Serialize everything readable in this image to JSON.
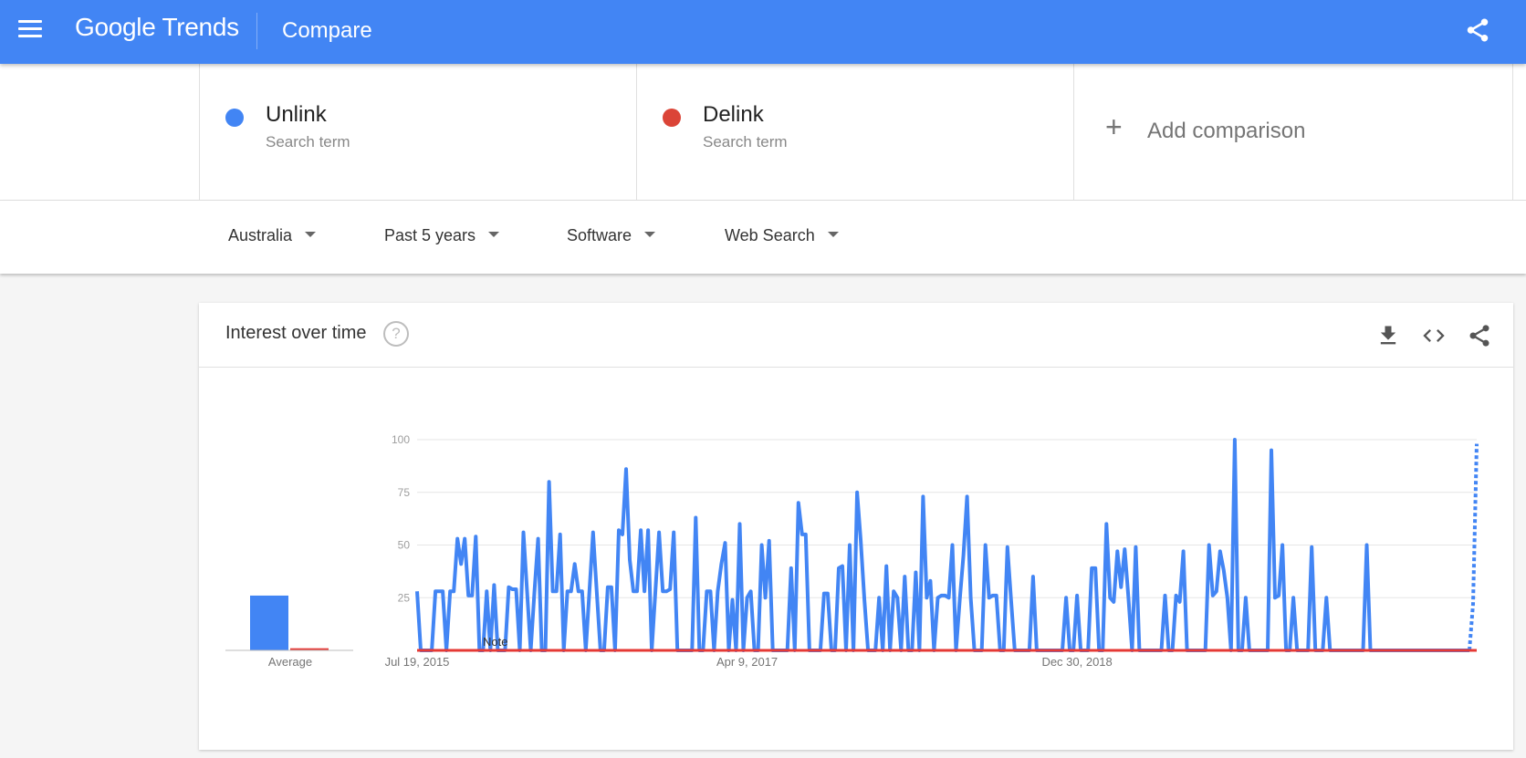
{
  "header": {
    "logo_google": "Google",
    "logo_trends": "Trends",
    "title": "Compare"
  },
  "terms": [
    {
      "name": "Unlink",
      "sub": "Search term",
      "color": "#4285f4"
    },
    {
      "name": "Delink",
      "sub": "Search term",
      "color": "#db4437"
    }
  ],
  "add_comparison": {
    "label": "Add comparison"
  },
  "filters": [
    "Australia",
    "Past 5 years",
    "Software",
    "Web Search"
  ],
  "card": {
    "title": "Interest over time",
    "help_glyph": "?"
  },
  "chart_data": {
    "type": "line",
    "x_tick_labels": [
      "Jul 19, 2015",
      "Apr 9, 2017",
      "Dec 30, 2018"
    ],
    "x_tick_index": [
      0,
      90,
      180
    ],
    "y_ticks": [
      25,
      50,
      75,
      100
    ],
    "ylim": [
      0,
      100
    ],
    "note_label": "Note",
    "average_label": "Average",
    "averages": [
      26,
      1
    ],
    "partial_from_index": 260,
    "series": [
      {
        "name": "Unlink",
        "color": "#4285f4",
        "values": [
          28,
          0,
          0,
          0,
          0,
          28,
          28,
          28,
          0,
          28,
          28,
          53,
          41,
          53,
          26,
          26,
          54,
          0,
          0,
          28,
          0,
          31,
          0,
          0,
          0,
          30,
          29,
          29,
          0,
          56,
          28,
          0,
          28,
          53,
          0,
          0,
          80,
          28,
          28,
          55,
          0,
          28,
          28,
          41,
          28,
          28,
          0,
          28,
          56,
          28,
          0,
          0,
          30,
          30,
          0,
          57,
          55,
          86,
          43,
          28,
          28,
          57,
          28,
          57,
          0,
          28,
          56,
          28,
          28,
          29,
          56,
          0,
          0,
          0,
          0,
          0,
          63,
          0,
          0,
          28,
          28,
          0,
          28,
          41,
          51,
          0,
          24,
          0,
          60,
          0,
          25,
          28,
          0,
          0,
          50,
          25,
          52,
          0,
          0,
          0,
          0,
          0,
          39,
          0,
          70,
          55,
          55,
          0,
          0,
          0,
          0,
          27,
          27,
          0,
          0,
          39,
          40,
          0,
          50,
          0,
          75,
          52,
          24,
          0,
          0,
          0,
          25,
          0,
          40,
          0,
          28,
          25,
          0,
          35,
          0,
          0,
          37,
          0,
          73,
          25,
          33,
          0,
          25,
          26,
          26,
          25,
          50,
          0,
          24,
          45,
          73,
          25,
          0,
          0,
          0,
          50,
          25,
          26,
          26,
          0,
          0,
          49,
          24,
          0,
          0,
          0,
          0,
          0,
          35,
          0,
          0,
          0,
          0,
          0,
          0,
          0,
          0,
          25,
          0,
          0,
          26,
          0,
          0,
          0,
          39,
          39,
          0,
          0,
          60,
          25,
          23,
          47,
          30,
          48,
          25,
          0,
          49,
          0,
          0,
          0,
          0,
          0,
          0,
          0,
          26,
          0,
          0,
          26,
          23,
          47,
          0,
          0,
          0,
          0,
          0,
          0,
          50,
          26,
          28,
          47,
          38,
          25,
          0,
          100,
          0,
          0,
          25,
          0,
          0,
          0,
          0,
          0,
          0,
          95,
          25,
          26,
          50,
          0,
          0,
          25,
          0,
          0,
          0,
          0,
          49,
          0,
          0,
          0,
          25,
          0,
          0,
          0,
          0,
          0,
          0,
          0,
          0,
          0,
          0,
          50,
          0,
          0,
          0,
          0,
          0,
          0,
          0,
          0,
          0,
          0,
          0,
          0,
          0,
          0,
          0,
          0,
          0,
          0,
          0,
          0,
          0,
          0,
          0,
          0,
          0,
          0,
          0,
          0
        ],
        "partial_values": [
          22,
          98
        ]
      },
      {
        "name": "Delink",
        "color": "#e53935",
        "values": []
      }
    ]
  }
}
